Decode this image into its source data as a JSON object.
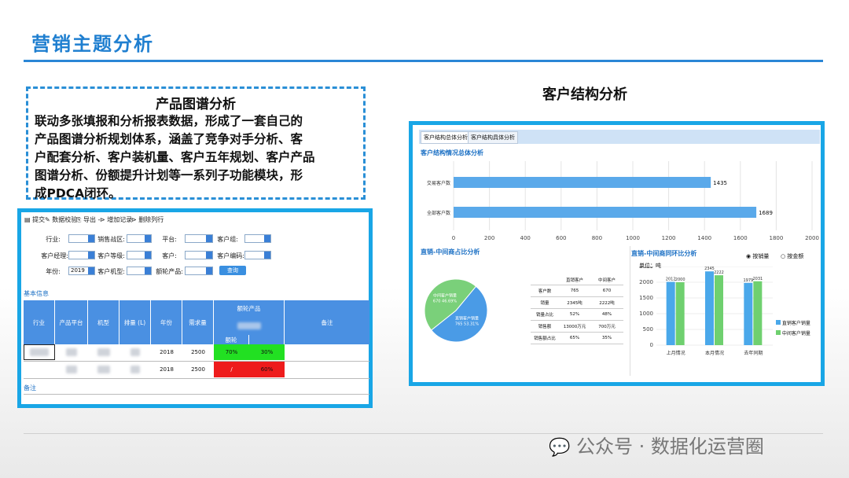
{
  "slide": {
    "title": "营销主题分析"
  },
  "desc": {
    "title": "产品图谱分析",
    "lines": [
      "联动多张填报和分析报表数据，形成了一套自己的",
      "产品图谱分析规划体系，涵盖了竞争对手分析、客",
      "户配套分析、客户装机量、客户五年规划、客户产品",
      "图谱分析、份额提升计划等一系列子功能模块，形",
      "成PDCA闭环。"
    ]
  },
  "left": {
    "toolbar": [
      "提交",
      "数据校验",
      "导出 -",
      "增加记录",
      "删除列行"
    ],
    "filters": {
      "r1": [
        "行业:",
        "销售战区:",
        "平台:",
        "客户组:"
      ],
      "r2": [
        "客户经理:",
        "客户等级:",
        "客户:",
        "客户编码:"
      ],
      "r3": [
        "年份:",
        "客户机型:",
        "额轮产品:"
      ],
      "year": "2019",
      "query": "查询"
    },
    "section1": "基本信息",
    "headers": [
      "行业",
      "产品平台",
      "机型",
      "排量 (L)",
      "年份",
      "需求量",
      "额轮产品",
      "备注"
    ],
    "subheaders": [
      "额轮"
    ],
    "rows": [
      {
        "year": "2018",
        "demand": "2500",
        "a": "70%",
        "b": "30%"
      },
      {
        "year": "2018",
        "demand": "2500",
        "a": "/",
        "b": "60%"
      }
    ],
    "section2": "备注"
  },
  "right": {
    "heading": "客户结构分析",
    "tabs": [
      "客户结构总体分析",
      "客户结构具体分析"
    ],
    "overall_title": "客户结构情况总体分析",
    "pie_title": "直销-中间商占比分析",
    "bar2_title": "直销-中间商同环比分析",
    "radio": [
      "按销量",
      "按金额"
    ],
    "unit": "单位：吨",
    "table_headers": [
      "",
      "直销客户",
      "中间客户"
    ],
    "table_rows": [
      [
        "客户数",
        "765",
        "670"
      ],
      [
        "销量",
        "2345吨",
        "2222吨"
      ],
      [
        "销量占比",
        "52%",
        "48%"
      ],
      [
        "销售额",
        "13000万元",
        "700万元"
      ],
      [
        "销售额占比",
        "65%",
        "35%"
      ]
    ]
  },
  "watermark": "公众号 · 数据化运营圈",
  "chart_data": [
    {
      "type": "bar",
      "orientation": "horizontal",
      "title": "客户结构情况总体分析",
      "categories": [
        "交易客户数",
        "全部客户数"
      ],
      "values": [
        1435,
        1689
      ],
      "xlim": [
        0,
        2000
      ],
      "xticks": [
        0,
        200,
        400,
        600,
        800,
        1000,
        1200,
        1400,
        1600,
        1800,
        2000
      ],
      "colors": [
        "#5aa9ea"
      ]
    },
    {
      "type": "pie",
      "title": "直销-中间商占比分析",
      "labels": [
        "直销客户销量",
        "中间客户销量"
      ],
      "values": [
        765,
        670
      ],
      "label_text": [
        "直销客户销量\n765 53.31%",
        "中间客户销量\n670 46.69%"
      ],
      "colors": [
        "#4a9be6",
        "#7ad07a"
      ]
    },
    {
      "type": "bar",
      "title": "直销-中间商同环比分析",
      "categories": [
        "上月情况",
        "本月情况",
        "去年同期"
      ],
      "series": [
        {
          "name": "直销客户销量",
          "values": [
            2012,
            2345,
            1979
          ],
          "color": "#4aa8ea"
        },
        {
          "name": "中间客户销量",
          "values": [
            2000,
            2222,
            2031
          ],
          "color": "#6fd06f"
        }
      ],
      "ylim": [
        0,
        2500
      ],
      "yticks": [
        0,
        500,
        1000,
        1500,
        2000,
        2500
      ],
      "ylabel": "单位：吨"
    }
  ]
}
